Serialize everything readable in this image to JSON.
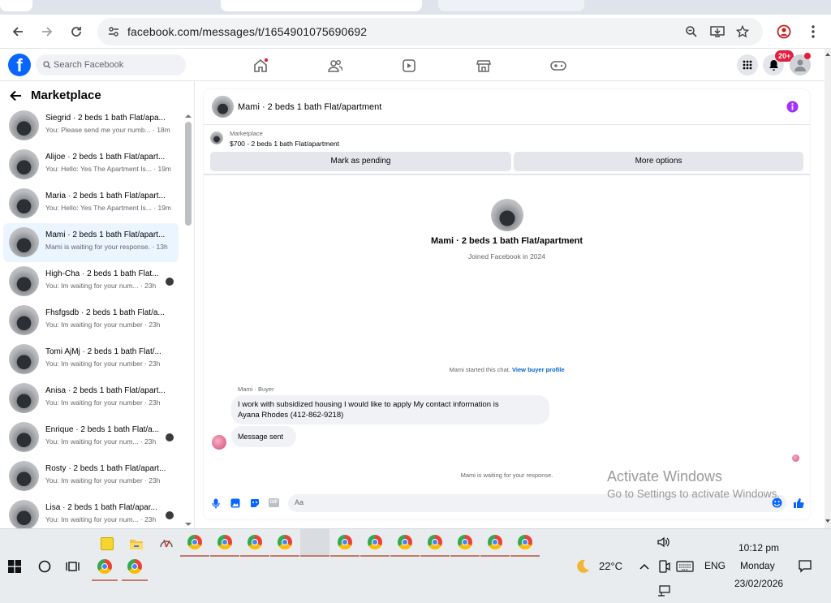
{
  "browser": {
    "url": "facebook.com/messages/t/1654901075690692",
    "back_icon": "arrow-left-icon",
    "forward_icon": "arrow-right-icon",
    "reload_icon": "reload-icon"
  },
  "facebook": {
    "search_placeholder": "Search Facebook",
    "notifications_badge": "20+"
  },
  "sidebar": {
    "title": "Marketplace",
    "conversations": [
      {
        "name": "Siegrid · 2 beds 1 bath Flat/apa...",
        "preview": "You: Please send me your numb...",
        "time": "18m",
        "selected": false
      },
      {
        "name": "Alijoe · 2 beds 1 bath Flat/apart...",
        "preview": "You: Hello: Yes The Apartment Is...",
        "time": "19m",
        "selected": false
      },
      {
        "name": "Maria · 2 beds 1 bath Flat/apart...",
        "preview": "You: Hello: Yes The Apartment Is...",
        "time": "19m",
        "selected": false
      },
      {
        "name": "Mami · 2 beds 1 bath Flat/apart...",
        "preview": "Mami is waiting for your response.",
        "time": "13h",
        "selected": true
      },
      {
        "name": "High-Cha · 2 beds 1 bath Flat...",
        "preview": "You: Im waiting for your num...",
        "time": "23h",
        "selected": false
      },
      {
        "name": "Fhsfgsdb · 2 beds 1 bath Flat/a...",
        "preview": "You: Im waiting for your number",
        "time": "23h",
        "selected": false
      },
      {
        "name": "Tomi AjMj · 2 beds 1 bath Flat/...",
        "preview": "You: Im waiting for your number",
        "time": "23h",
        "selected": false
      },
      {
        "name": "Anisa · 2 beds 1 bath Flat/apart...",
        "preview": "You: Im waiting for your number",
        "time": "23h",
        "selected": false
      },
      {
        "name": "Enrique · 2 beds 1 bath Flat/a...",
        "preview": "You: Im waiting for your num...",
        "time": "23h",
        "selected": false
      },
      {
        "name": "Rosty · 2 beds 1 bath Flat/apart...",
        "preview": "You: Im waiting for your number",
        "time": "23h",
        "selected": false
      },
      {
        "name": "Lisa · 2 beds 1 bath Flat/apar...",
        "preview": "You: Im waiting for your num...",
        "time": "23h",
        "selected": false
      }
    ]
  },
  "chat": {
    "header_title": "Mami · 2 beds 1 bath Flat/apartment",
    "marketplace_label": "Marketplace",
    "listing": "$700 - 2 beds 1 bath Flat/apartment",
    "mark_pending": "Mark as pending",
    "more_options": "More options",
    "profile_name": "Mami · 2 beds 1 bath Flat/apartment",
    "joined": "Joined Facebook in 2024",
    "started_text": "Mami started this chat.",
    "view_buyer": "View buyer profile",
    "sender_label": "Mami · Buyer",
    "message_line1": "I work with subsidized housing I would like to apply My contact information is",
    "message_line2": "Ayana Rhodes (412-862-9218)",
    "message_sent": "Message sent",
    "waiting": "Mami is waiting for your response.",
    "input_placeholder": "Aa"
  },
  "watermark": {
    "line1": "Activate Windows",
    "line2": "Go to Settings to activate Windows."
  },
  "taskbar": {
    "weather_temp": "22°C",
    "language": "ENG",
    "time": "10:12 pm",
    "day": "Monday",
    "date": "23/02/2026"
  }
}
